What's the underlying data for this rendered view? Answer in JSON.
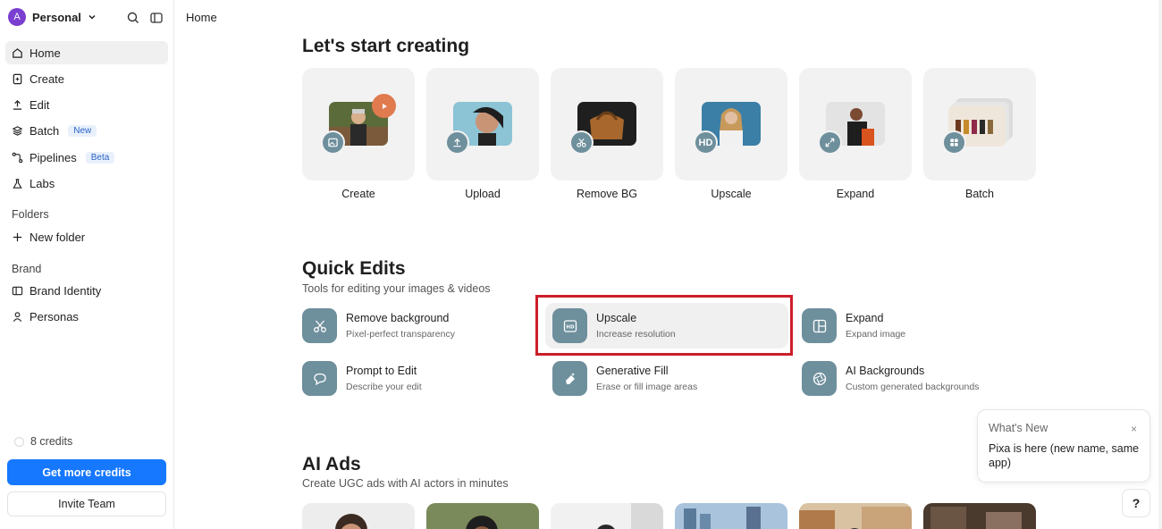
{
  "workspace": {
    "avatar_letter": "A",
    "name": "Personal"
  },
  "nav": [
    {
      "label": "Home",
      "icon": "home-icon",
      "active": true
    },
    {
      "label": "Create",
      "icon": "create-icon"
    },
    {
      "label": "Edit",
      "icon": "edit-icon"
    },
    {
      "label": "Batch",
      "icon": "layers-icon",
      "badge": "New"
    },
    {
      "label": "Pipelines",
      "icon": "pipelines-icon",
      "badge": "Beta"
    },
    {
      "label": "Labs",
      "icon": "flask-icon"
    }
  ],
  "folders": {
    "label": "Folders",
    "new_folder": "New folder"
  },
  "brand": {
    "label": "Brand",
    "identity": "Brand Identity",
    "personas": "Personas"
  },
  "credits": {
    "text": "8 credits",
    "get_more": "Get more credits",
    "invite": "Invite Team"
  },
  "breadcrumb": "Home",
  "start": {
    "title": "Let's start creating",
    "cards": [
      {
        "label": "Create",
        "badge_icon": "image-icon"
      },
      {
        "label": "Upload",
        "badge_icon": "upload-icon"
      },
      {
        "label": "Remove BG",
        "badge_icon": "scissors-icon"
      },
      {
        "label": "Upscale",
        "badge_text": "HD"
      },
      {
        "label": "Expand",
        "badge_icon": "expand-icon"
      },
      {
        "label": "Batch",
        "badge_icon": "grid-icon"
      }
    ]
  },
  "quick_edits": {
    "title": "Quick Edits",
    "subtitle": "Tools for editing your images & videos",
    "items": [
      {
        "title": "Remove background",
        "desc": "Pixel-perfect transparency"
      },
      {
        "title": "Upscale",
        "desc": "Increase resolution"
      },
      {
        "title": "Expand",
        "desc": "Expand image"
      },
      {
        "title": "Prompt to Edit",
        "desc": "Describe your edit"
      },
      {
        "title": "Generative Fill",
        "desc": "Erase or fill image areas"
      },
      {
        "title": "AI Backgrounds",
        "desc": "Custom generated backgrounds"
      }
    ]
  },
  "ai_ads": {
    "title": "AI Ads",
    "subtitle": "Create UGC ads with AI actors in minutes"
  },
  "whats_new": {
    "title": "What's New",
    "close": "×",
    "body": "Pixa is here (new name, same app)"
  },
  "help": "?",
  "colors": {
    "accent": "#1677ff",
    "icon_tile": "#6e8f9c",
    "highlight": "#cc1f2b",
    "avatar": "#7a3fd0"
  }
}
